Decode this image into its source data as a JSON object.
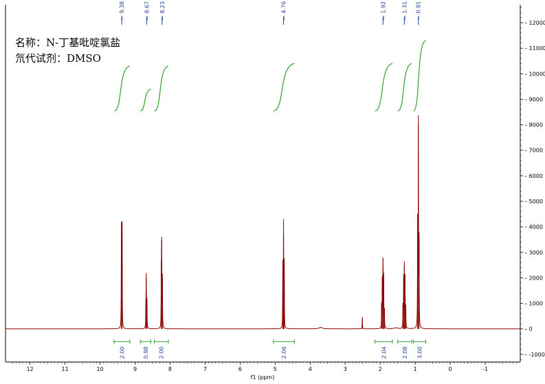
{
  "annotations": {
    "line1": "名称：N-丁基吡啶氯盐",
    "line2": "氘代试剂：DMSO"
  },
  "chart_data": {
    "type": "line",
    "title": "",
    "xlabel": "f1 (ppm)",
    "ylabel": "",
    "xlim": [
      12.7,
      -2.0
    ],
    "ylim": [
      -1300,
      12700
    ],
    "x_ticks": [
      "12",
      "11",
      "10",
      "9",
      "8",
      "7",
      "6",
      "5",
      "4",
      "3",
      "2",
      "1",
      "0",
      "-1"
    ],
    "y_ticks": [
      "-1000",
      "0",
      "1000",
      "2000",
      "3000",
      "4000",
      "5000",
      "6000",
      "7000",
      "8000",
      "9000",
      "10000",
      "11000",
      "12000"
    ],
    "colors": {
      "spectrum": "#8b0000",
      "integral": "#2ca02c",
      "label": "#1f3f9f",
      "axis": "#000000"
    },
    "peak_labels": [
      "9.38",
      "8.67",
      "8.23",
      "4.76",
      "1.92",
      "1.31",
      "0.91"
    ],
    "peaks": [
      {
        "center": 9.38,
        "lines": [
          {
            "x": 9.39,
            "h": 4200
          },
          {
            "x": 9.37,
            "h": 4150
          }
        ]
      },
      {
        "center": 8.67,
        "lines": [
          {
            "x": 8.69,
            "h": 1000
          },
          {
            "x": 8.68,
            "h": 2050
          },
          {
            "x": 8.66,
            "h": 1200
          }
        ]
      },
      {
        "center": 8.23,
        "lines": [
          {
            "x": 8.25,
            "h": 2300
          },
          {
            "x": 8.24,
            "h": 3600
          },
          {
            "x": 8.22,
            "h": 2000
          }
        ]
      },
      {
        "center": 4.76,
        "lines": [
          {
            "x": 4.78,
            "h": 2500
          },
          {
            "x": 4.76,
            "h": 4300
          },
          {
            "x": 4.74,
            "h": 2550
          }
        ]
      },
      {
        "center": 2.51,
        "lines": [
          {
            "x": 2.51,
            "h": 450
          }
        ]
      },
      {
        "center": 1.92,
        "lines": [
          {
            "x": 1.96,
            "h": 900
          },
          {
            "x": 1.94,
            "h": 2000
          },
          {
            "x": 1.92,
            "h": 2800
          },
          {
            "x": 1.9,
            "h": 2000
          },
          {
            "x": 1.88,
            "h": 800
          }
        ]
      },
      {
        "center": 1.31,
        "lines": [
          {
            "x": 1.35,
            "h": 900
          },
          {
            "x": 1.33,
            "h": 2000
          },
          {
            "x": 1.31,
            "h": 2650
          },
          {
            "x": 1.29,
            "h": 1950
          },
          {
            "x": 1.27,
            "h": 900
          }
        ]
      },
      {
        "center": 0.91,
        "lines": [
          {
            "x": 0.93,
            "h": 4500
          },
          {
            "x": 0.91,
            "h": 8000
          },
          {
            "x": 0.89,
            "h": 3800
          }
        ]
      }
    ],
    "integrals": [
      {
        "start": 9.6,
        "end": 9.15,
        "value": "2.00",
        "ybase": 8600,
        "ytop": 10300
      },
      {
        "start": 8.85,
        "end": 8.55,
        "value": "0.98",
        "ybase": 8600,
        "ytop": 9400
      },
      {
        "start": 8.45,
        "end": 8.05,
        "value": "2.00",
        "ybase": 8600,
        "ytop": 10300
      },
      {
        "start": 5.05,
        "end": 4.45,
        "value": "2.06",
        "ybase": 8600,
        "ytop": 10400
      },
      {
        "start": 2.15,
        "end": 1.65,
        "value": "2.04",
        "ybase": 8600,
        "ytop": 10400
      },
      {
        "start": 1.5,
        "end": 1.1,
        "value": "2.08",
        "ybase": 8600,
        "ytop": 10400
      },
      {
        "start": 1.05,
        "end": 0.7,
        "value": "3.00",
        "ybase": 8600,
        "ytop": 11300
      }
    ],
    "grid": false,
    "legend": "none"
  }
}
